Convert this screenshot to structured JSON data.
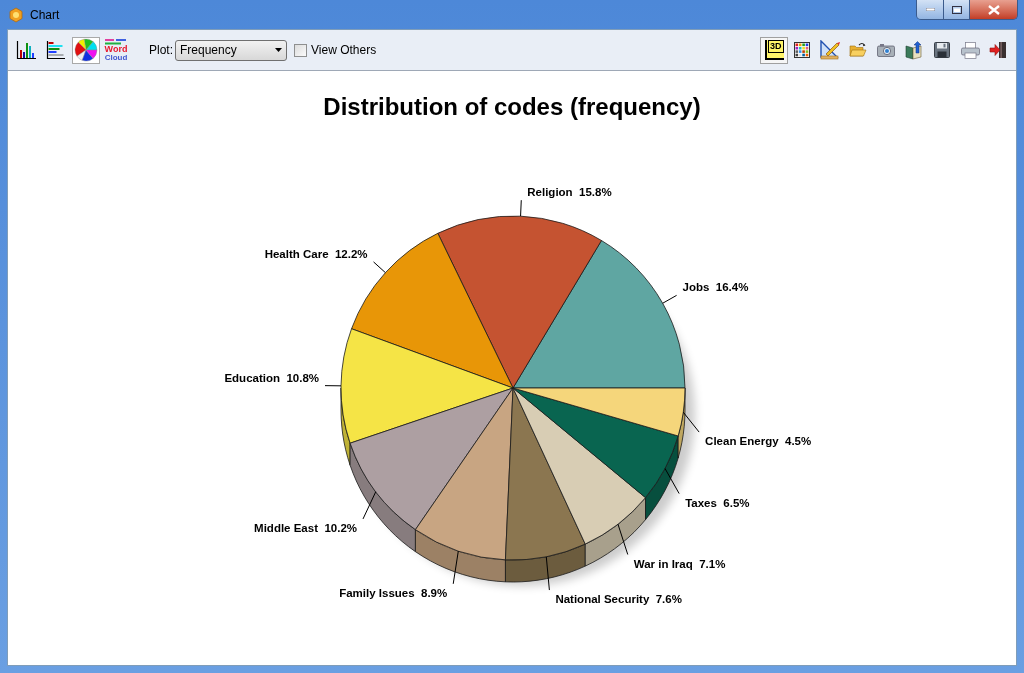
{
  "window": {
    "title": "Chart"
  },
  "toolbar": {
    "view_buttons": [
      {
        "selected": false
      },
      {
        "selected": false
      },
      {
        "selected": true
      },
      {
        "selected": false,
        "label_lines": [
          "Word",
          "Cloud"
        ]
      }
    ],
    "plot": {
      "label": "Plot:",
      "value": "Frequency"
    },
    "view_others": {
      "label": "View Others",
      "checked": false
    },
    "toggle_3d": {
      "label": "3D",
      "on": true
    }
  },
  "chart": {
    "chart_data": {
      "type": "pie",
      "title": "Distribution of codes (frequency)",
      "categories": [
        "Jobs",
        "Religion",
        "Health Care",
        "Education",
        "Middle East",
        "Family Issues",
        "National Security",
        "War in Iraq",
        "Taxes",
        "Clean Energy"
      ],
      "values": [
        16.4,
        15.8,
        12.2,
        10.8,
        10.2,
        8.9,
        7.6,
        7.1,
        6.5,
        4.5
      ],
      "colors": [
        "#5fa6a2",
        "#c55331",
        "#e89607",
        "#f5e446",
        "#ad9fa2",
        "#c8a582",
        "#8b7650",
        "#d8cdb4",
        "#096550",
        "#f5d67b"
      ],
      "value_labels": [
        "16.4%",
        "15.8%",
        "12.2%",
        "10.8%",
        "10.2%",
        "8.9%",
        "7.6%",
        "7.1%",
        "6.5%",
        "4.5%"
      ]
    }
  }
}
